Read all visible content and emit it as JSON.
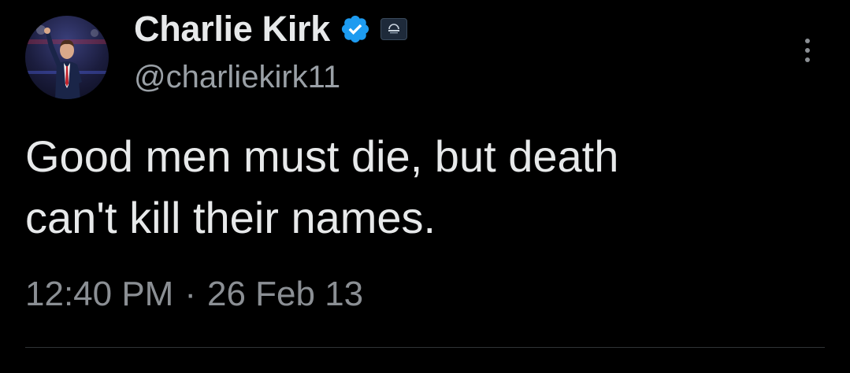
{
  "author": {
    "display_name": "Charlie Kirk",
    "handle": "@charliekirk11",
    "verified": true,
    "verified_color": "#1d9bf0",
    "affiliation_badge": "organization-logo"
  },
  "tweet": {
    "text": "Good men must die, but death\ncan't kill their names.",
    "time": "12:40 PM",
    "separator": "·",
    "date": "26 Feb 13"
  },
  "icons": {
    "more": "more-options-icon",
    "verified": "verified-badge-icon"
  },
  "colors": {
    "background": "#000000",
    "primary_text": "#e7e9ea",
    "secondary_text": "#8b8f94",
    "divider": "#2f3336"
  }
}
